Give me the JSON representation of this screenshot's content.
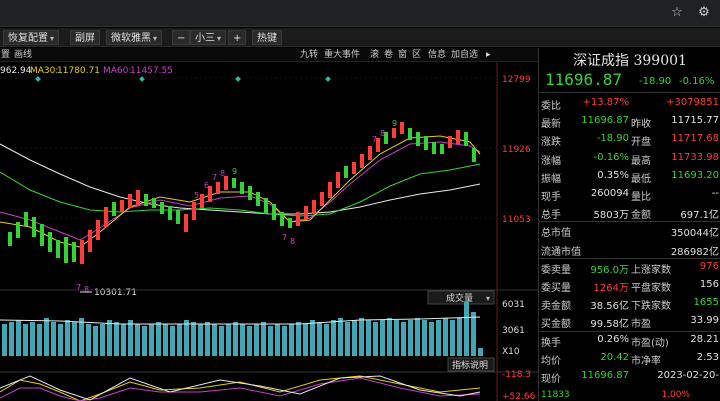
{
  "toolbar": {
    "restore_config": "恢复配置",
    "sub_screen": "副屏",
    "font_name": "微软雅黑",
    "minus": "−",
    "font_size": "小三",
    "plus": "+",
    "hotkey": "热键"
  },
  "subbar": {
    "left_items": [
      "置",
      "画线"
    ],
    "right_items": [
      "九转",
      "重大事件",
      "滚",
      "卷",
      "窗",
      "区",
      "信息",
      "加自选"
    ]
  },
  "ma_legend": {
    "ma_prev": "962.94",
    "ma30_label": "MA30:",
    "ma30_value": "11780.71",
    "ma60_label": "MA60:",
    "ma60_value": "11457.55"
  },
  "price_axis": {
    "ticks": [
      "12799",
      "11926",
      "11053"
    ],
    "low_marker": "10301.71"
  },
  "volume": {
    "button": "成交量",
    "ticks": [
      "6031",
      "3061"
    ],
    "unit": "X10",
    "help_button": "指标说明"
  },
  "osc_axis": {
    "ticks": [
      "118.3",
      "52.66"
    ]
  },
  "panel": {
    "title": "深证成指 399001",
    "price": "11696.87",
    "change": "-18.90",
    "change_pct": "-0.16%",
    "rows": [
      {
        "l1": "委比",
        "v1": "+13.87%",
        "v2": "+3079851",
        "c1": "red",
        "c2": "red"
      },
      {
        "l1": "最新",
        "v1": "11696.87",
        "l2": "昨收",
        "v2": "11715.77",
        "c1": "grn",
        "c2": "wht"
      },
      {
        "l1": "涨跌",
        "v1": "-18.90",
        "l2": "开盘",
        "v2": "11717.68",
        "c1": "grn",
        "c2": "red"
      },
      {
        "l1": "涨幅",
        "v1": "-0.16%",
        "l2": "最高",
        "v2": "11733.98",
        "c1": "grn",
        "c2": "red"
      },
      {
        "l1": "振幅",
        "v1": "0.35%",
        "l2": "最低",
        "v2": "11693.20",
        "c1": "wht",
        "c2": "grn"
      },
      {
        "l1": "现手",
        "v1": "260094",
        "l2": "量比",
        "v2": "--",
        "c1": "wht",
        "c2": "wht"
      },
      {
        "l1": "总手",
        "v1": "5803万",
        "l2": "金额",
        "v2": "697.1亿",
        "c1": "wht",
        "c2": "wht"
      },
      {
        "l1": "总市值",
        "v1": "",
        "v2": "350044亿",
        "c1": "wht",
        "c2": "wht"
      },
      {
        "l1": "流通市值",
        "v1": "",
        "v2": "286982亿",
        "c1": "wht",
        "c2": "wht"
      },
      {
        "l1": "委卖量",
        "v1": "956.0万",
        "l2": "上涨家数",
        "v2": "976",
        "c1": "grn",
        "c2": "red"
      },
      {
        "l1": "委买量",
        "v1": "1264万",
        "l2": "平盘家数",
        "v2": "156",
        "c1": "red",
        "c2": "wht"
      },
      {
        "l1": "卖金额",
        "v1": "38.56亿",
        "l2": "下跌家数",
        "v2": "1655",
        "c1": "wht",
        "c2": "grn"
      },
      {
        "l1": "买金额",
        "v1": "99.58亿",
        "l2": "市盈",
        "v2": "33.99",
        "c1": "wht",
        "c2": "wht"
      },
      {
        "l1": "换手",
        "v1": "0.26%",
        "l2": "市盈(动)",
        "v2": "28.21",
        "c1": "wht",
        "c2": "wht"
      },
      {
        "l1": "均价",
        "v1": "20.42",
        "l2": "市净率",
        "v2": "2.53",
        "c1": "grn",
        "c2": "wht"
      },
      {
        "l1": "现价",
        "v1": "11696.87",
        "l2": "",
        "v2": "2023-02-20-",
        "c1": "grn",
        "c2": "wht"
      }
    ],
    "footer_left": "11833",
    "footer_right": "1.00%"
  },
  "colors": {
    "up": "#ff3b3b",
    "down": "#35d235",
    "ma_white": "#e8e8e8",
    "ma_yellow": "#e6d200",
    "ma_purple": "#c640c6",
    "ma_green": "#35d235",
    "volume_bar": "#3fa7b5"
  }
}
